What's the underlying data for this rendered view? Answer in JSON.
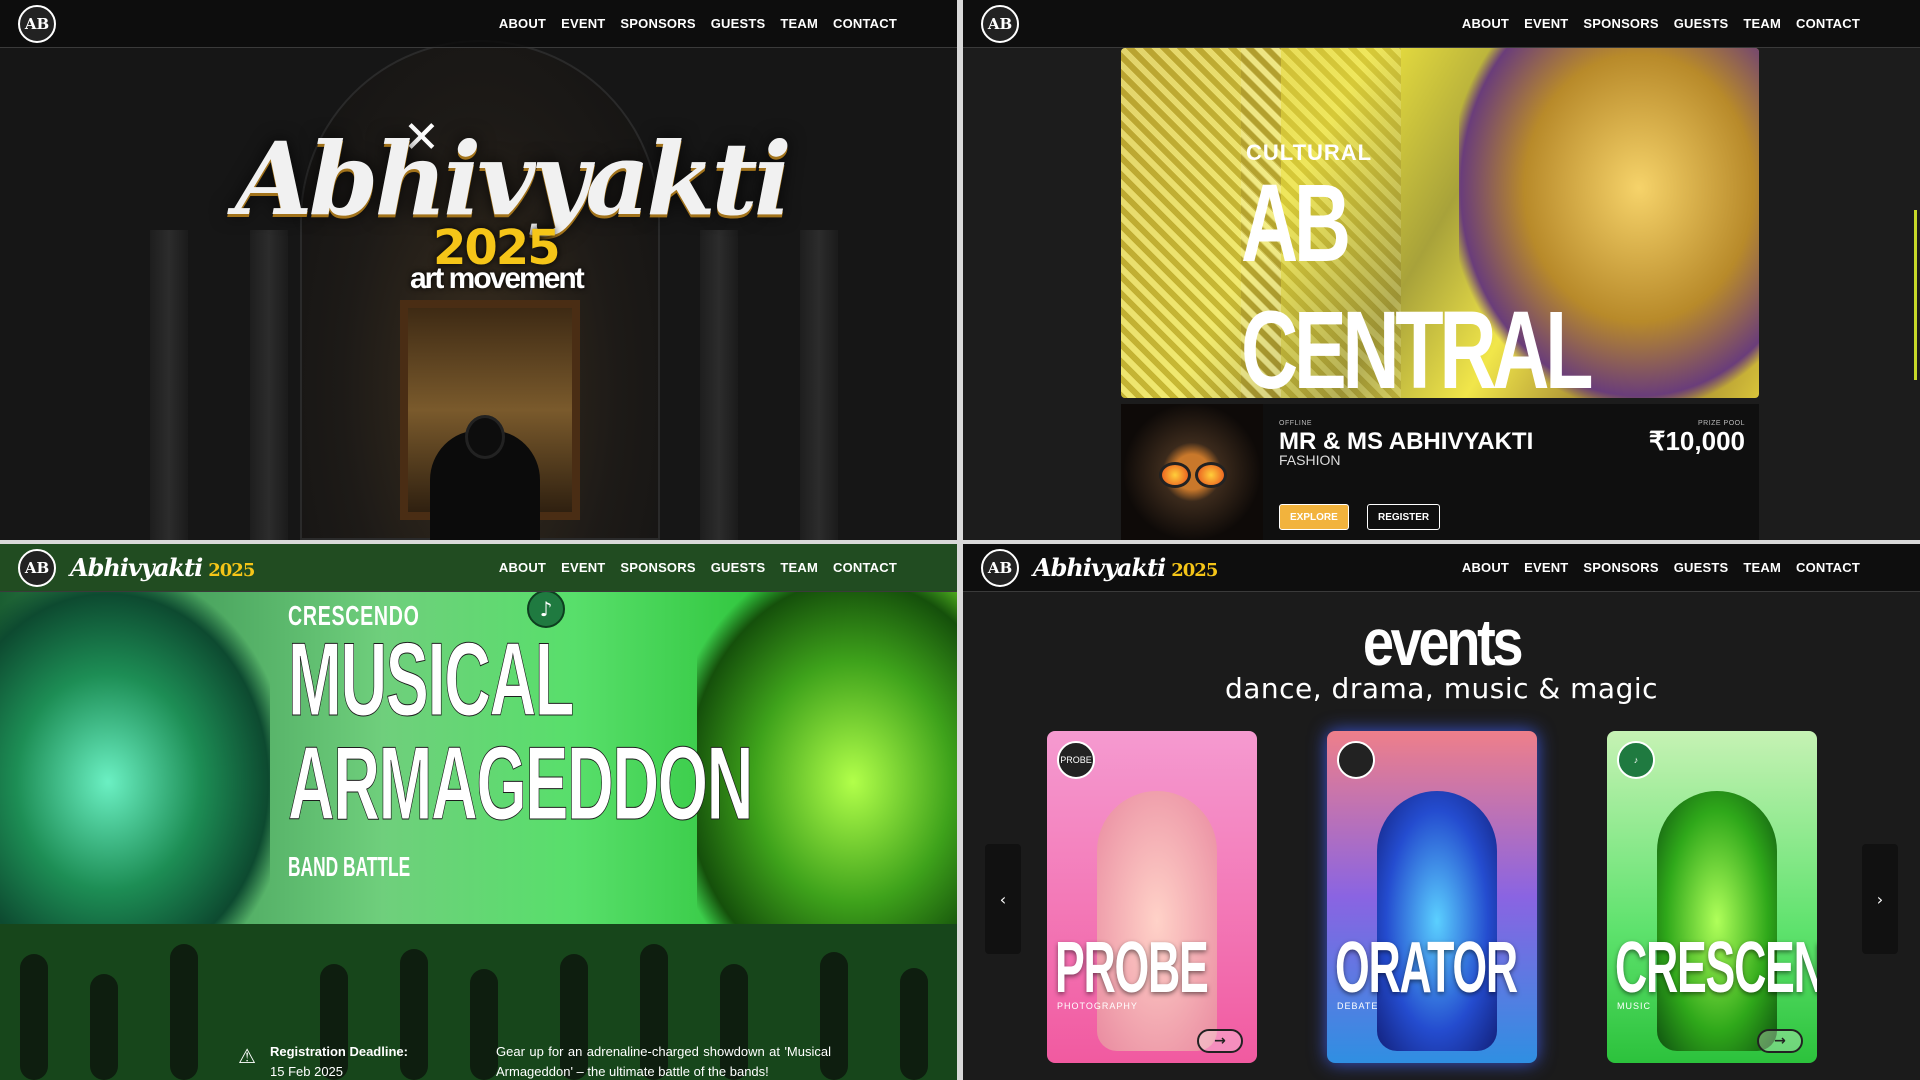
{
  "nav": {
    "logo_text": "AB",
    "brand": "Abhivyakti",
    "brand_year": "2025",
    "menu": [
      "ABOUT",
      "EVENT",
      "SPONSORS",
      "GUESTS",
      "TEAM",
      "CONTACT"
    ]
  },
  "hero": {
    "title": "Abhivyakti",
    "year": "2025",
    "subtitle": "art movement"
  },
  "ab_central": {
    "kicker": "CULTURAL",
    "title": "AB CENTRAL",
    "card": {
      "mode_label": "OFFLINE",
      "title": "MR & MS ABHIVYAKTI",
      "category": "FASHION",
      "prize_label": "PRIZE POOL",
      "prize": "₹10,000",
      "explore_label": "EXPLORE",
      "register_label": "REGISTER"
    }
  },
  "crescendo": {
    "kicker": "CRESCENDO",
    "title_line1": "MUSICAL",
    "title_line2": "ARMAGEDDON",
    "tag": "BAND BATTLE",
    "music_icon": "♪",
    "deadline_label": "Registration Deadline:",
    "deadline_date": "15 Feb 2025",
    "description": "Gear up for an adrenaline-charged showdown at 'Musical Armageddon' – the ultimate battle of the bands!"
  },
  "events": {
    "title": "events",
    "subtitle": "dance, drama, music & magic",
    "prev": "‹",
    "next": "›",
    "cards": [
      {
        "name": "PROBE",
        "category": "PHOTOGRAPHY",
        "badge": "PROBE",
        "bg": "#f46db0"
      },
      {
        "name": "ORATOR",
        "category": "DEBATE",
        "badge": "",
        "bg": "#4a76e2"
      },
      {
        "name": "CRESCENDO",
        "category": "MUSIC",
        "badge": "♪",
        "bg": "#58d46a"
      }
    ]
  }
}
